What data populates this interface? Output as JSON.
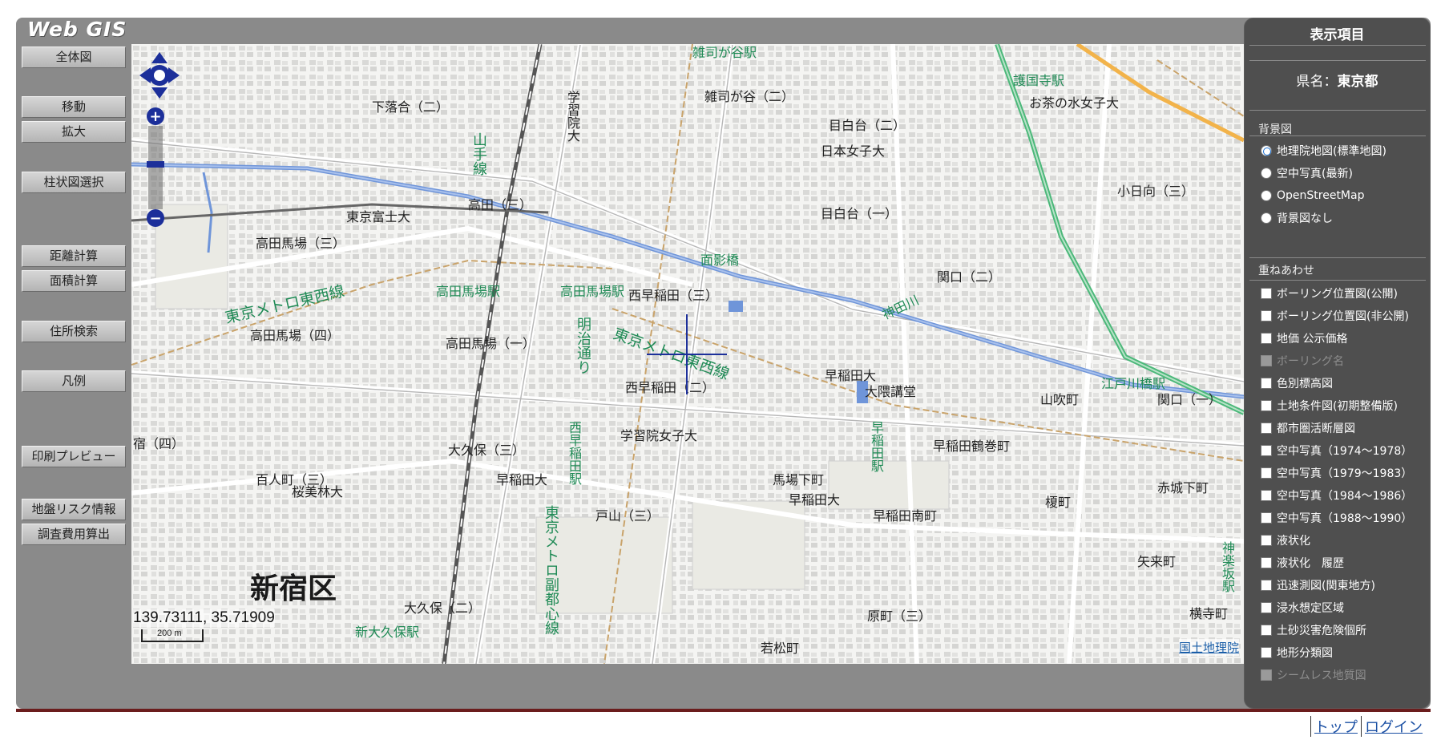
{
  "app": {
    "logo": "Web GIS"
  },
  "toolbar": {
    "overview": "全体図",
    "move": "移動",
    "zoom": "拡大",
    "column_select": "柱状図選択",
    "distance": "距離計算",
    "area": "面積計算",
    "address_search": "住所検索",
    "legend": "凡例",
    "print_preview": "印刷プレビュー",
    "ground_risk": "地盤リスク情報",
    "survey_cost": "調査費用算出"
  },
  "map": {
    "coordinates": "139.73111, 35.71909",
    "scale_label": "200 m",
    "attribution": "国土地理院",
    "labels": {
      "shinjuku_ku": "新宿区",
      "takadanobaba_station": "高田馬場駅",
      "takadanobaba_station_2": "高田馬場駅",
      "tozai_line": "東京メトロ東西線",
      "tozai_line_2": "東京メトロ東西線",
      "yamanote_line": "山手線",
      "meiji_dori": "明治通り",
      "fukutoshin_line": "東京メトロ副都心線",
      "nishi_waseda_station": "西早稲田駅",
      "waseda_station": "早稲田駅",
      "gokokuji_station": "護国寺駅",
      "edogawabashi_station": "江戸川橋駅",
      "kagurazaka_station": "神楽坂駅",
      "shin_okubo_station": "新大久保駅",
      "zoshigaya_station": "雑司が谷駅",
      "omokage_bashi": "面影橋",
      "kanda_river": "神田川",
      "ochanomizu_univ": "お茶の水女子大",
      "japan_womens_univ": "日本女子大",
      "gakushuin_univ": "学習院大",
      "gakushuin_womens_univ": "学習院女子大",
      "waseda_univ": "早稲田大",
      "waseda_univ_2": "早稲田大",
      "waseda_univ_3": "早稲田大",
      "okuma_auditorium": "大隈講堂",
      "takadanobaba_3": "高田馬場（三）",
      "takadanobaba_4": "高田馬場（四）",
      "takadanobaba_1": "高田馬場（一）",
      "takada_3": "高田（三）",
      "nishiwaseda_3": "西早稲田（三）",
      "nishiwaseda_2": "西早稲田（二）",
      "mejirodai_2": "目白台（二）",
      "mejirodai_1": "目白台（一）",
      "sekiguchi_2": "関口（二）",
      "sekiguchi_1": "関口（一）",
      "shimoochiai_2": "下落合（二）",
      "zoshigaya_2": "雑司が谷（二）",
      "okubo_3": "大久保（三）",
      "okubo_2": "大久保（二）",
      "hyakunincho_3": "百人町（三）",
      "toyama_3": "戸山（三）",
      "babashitacho": "馬場下町",
      "waseda_tsurumakicho": "早稲田鶴巻町",
      "waseda_minamicho": "早稲田南町",
      "yamabukicho": "山吹町",
      "enokicho": "榎町",
      "akagishitamachi": "赤城下町",
      "yaraicho": "矢来町",
      "yokoteramachi": "横寺町",
      "haramachi_3": "原町（三）",
      "wakamatsucho": "若松町",
      "kohinata_3": "小日向（三）",
      "tokyo_fuji_univ": "東京富士大",
      "oka_shiken": "桜美林大",
      "shinjuku_4": "宿（四）"
    }
  },
  "panel": {
    "title": "表示項目",
    "prefecture_label": "県名：",
    "prefecture_value": "東京都",
    "background_label": "背景図",
    "background_options": [
      {
        "label": "地理院地図(標準地図)",
        "selected": true
      },
      {
        "label": "空中写真(最新)",
        "selected": false
      },
      {
        "label": "OpenStreetMap",
        "selected": false
      },
      {
        "label": "背景図なし",
        "selected": false
      }
    ],
    "overlay_label": "重ねあわせ",
    "overlay_options": [
      {
        "label": "ボーリング位置図(公開)",
        "disabled": false
      },
      {
        "label": "ボーリング位置図(非公開)",
        "disabled": false
      },
      {
        "label": "地価 公示価格",
        "disabled": false
      },
      {
        "label": "ボーリング名",
        "disabled": true
      },
      {
        "label": "色別標高図",
        "disabled": false
      },
      {
        "label": "土地条件図(初期整備版)",
        "disabled": false
      },
      {
        "label": "都市圏活断層図",
        "disabled": false
      },
      {
        "label": "空中写真（1974～1978）",
        "disabled": false
      },
      {
        "label": "空中写真（1979～1983）",
        "disabled": false
      },
      {
        "label": "空中写真（1984～1986）",
        "disabled": false
      },
      {
        "label": "空中写真（1988～1990）",
        "disabled": false
      },
      {
        "label": "液状化",
        "disabled": false
      },
      {
        "label": "液状化　履歴",
        "disabled": false
      },
      {
        "label": "迅速測図(関東地方)",
        "disabled": false
      },
      {
        "label": "浸水想定区域",
        "disabled": false
      },
      {
        "label": "土砂災害危険個所",
        "disabled": false
      },
      {
        "label": "地形分類図",
        "disabled": false
      },
      {
        "label": "シームレス地質図",
        "disabled": true
      }
    ]
  },
  "footer": {
    "top_link": "トップ",
    "login_link": "ログイン"
  },
  "colors": {
    "frame": "#8a8a8a",
    "panel": "#4f4f4f",
    "rail_green": "#4cb87a",
    "river_blue": "#6f95d9",
    "nav_blue": "#1c2f9a",
    "divider": "#6b1d1d"
  }
}
